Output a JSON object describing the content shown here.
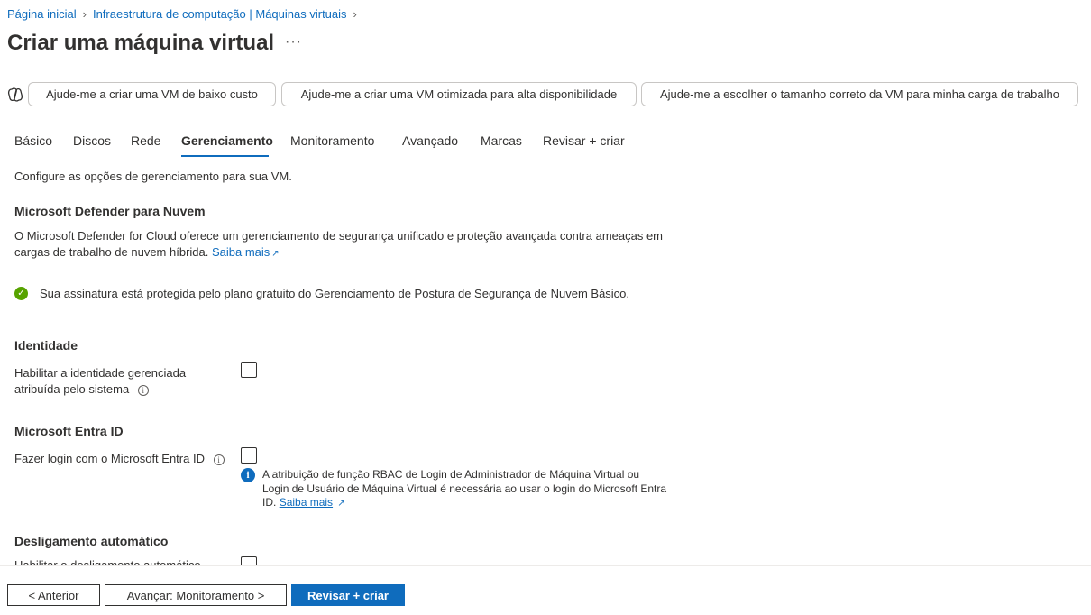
{
  "breadcrumb": {
    "items": [
      "Página inicial",
      "Infraestrutura de computação | Máquinas virtuais"
    ]
  },
  "header": {
    "title": "Criar uma máquina virtual",
    "more": "···"
  },
  "copilot_prompts": [
    "Ajude-me a criar uma VM de baixo custo",
    "Ajude-me a criar uma VM otimizada para alta disponibilidade",
    "Ajude-me a escolher o tamanho correto da VM para minha carga de trabalho"
  ],
  "tabs": [
    {
      "label": "Básico"
    },
    {
      "label": "Discos"
    },
    {
      "label": "Rede"
    },
    {
      "label": "Gerenciamento",
      "active": true
    },
    {
      "label": "Monitoramento"
    },
    {
      "label": "Avançado"
    },
    {
      "label": "Marcas"
    },
    {
      "label": "Revisar + criar"
    }
  ],
  "intro": "Configure as opções de gerenciamento para sua VM.",
  "defender": {
    "heading": "Microsoft Defender para Nuvem",
    "text": "O Microsoft Defender for Cloud oferece um gerenciamento de segurança unificado e proteção avançada contra ameaças em cargas de trabalho de nuvem híbrida.",
    "link": "Saiba mais",
    "status": "Sua assinatura está protegida pelo plano gratuito do Gerenciamento de Postura de Segurança de Nuvem Básico."
  },
  "identity": {
    "heading": "Identidade",
    "label": "Habilitar a identidade gerenciada atribuída pelo sistema",
    "checked": false
  },
  "entra": {
    "heading": "Microsoft Entra ID",
    "label": "Fazer login com o Microsoft Entra ID",
    "checked": false,
    "info": "A atribuição de função RBAC de Login de Administrador de Máquina Virtual ou Login de Usuário de Máquina Virtual é necessária ao usar o login do Microsoft Entra ID.",
    "info_link": "Saiba mais"
  },
  "autoshutdown": {
    "heading": "Desligamento automático",
    "label": "Habilitar o desligamento automático"
  },
  "footer": {
    "prev": "< Anterior",
    "next": "Avançar: Monitoramento >",
    "review": "Revisar + criar"
  },
  "colors": {
    "accent": "#0f6cbd",
    "success": "#57a300",
    "text": "#323130"
  }
}
